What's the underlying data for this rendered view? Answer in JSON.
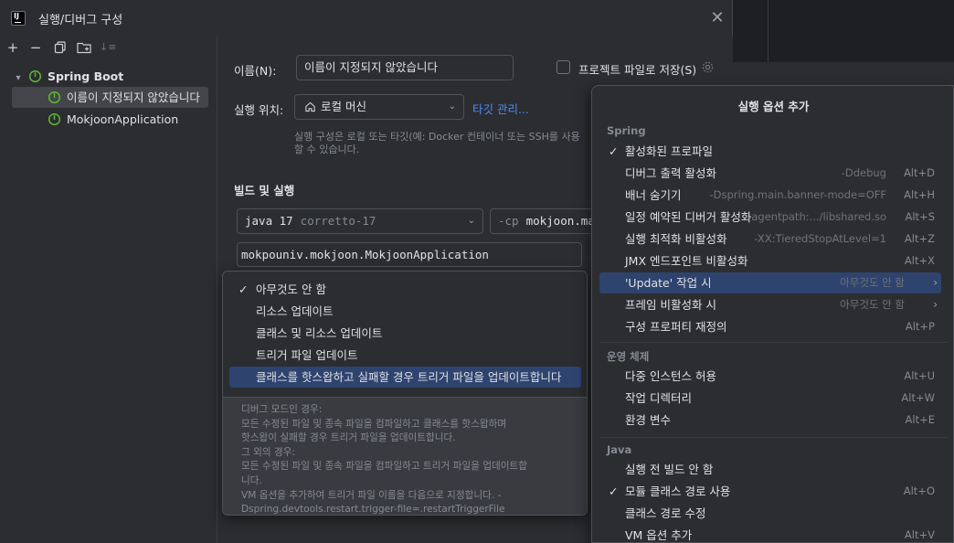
{
  "dialog": {
    "title": "실행/디버그 구성"
  },
  "tree": {
    "group": "Spring Boot",
    "items": [
      "이름이 지정되지 않았습니다",
      "MokjoonApplication"
    ]
  },
  "form": {
    "name_label": "이름(N):",
    "name_value": "이름이 지정되지 않았습니다",
    "save_file_label": "프로젝트 파일로 저장(S)",
    "location_label": "실행 위치:",
    "location_value": "로컬 머신",
    "manage_targets": "타깃 관리...",
    "location_hint_1": "실행 구성은 로컬 또는 타깃(예: Docker 컨테이너 또는 SSH를 사용",
    "location_hint_2": "할 수 있습니다.",
    "build_section": "빌드 및 실행",
    "jdk_name": "java 17",
    "jdk_vendor": "corretto-17",
    "cp_flag": "-cp",
    "cp_value": "mokjoon.mai",
    "main_class": "mokpouniv.mokjoon.MokjoonApplication"
  },
  "update_popup": {
    "items": [
      {
        "label": "아무것도 안 함",
        "checked": true
      },
      {
        "label": "리소스 업데이트"
      },
      {
        "label": "클래스 및 리소스 업데이트"
      },
      {
        "label": "트리거 파일 업데이트"
      },
      {
        "label": "클래스를 핫스왑하고 실패할 경우 트리거 파일을 업데이트합니다",
        "selected": true
      }
    ],
    "description": [
      "디버그 모드인 경우:",
      "모든 수정된 파일 및 종속 파일을 컴파일하고 클래스를 핫스왑하며",
      "핫스왑이 실패할 경우 트리거 파일을 업데이트합니다.",
      "그 외의 경우:",
      "모든 수정된 파일 및 종속 파일을 컴파일하고 트리거 파일을 업데이트합",
      "니다.",
      "VM 옵션을 추가하여 트리거 파일 이름을 다음으로 지정합니다. -",
      "Dspring.devtools.restart.trigger-file=.restartTriggerFile"
    ]
  },
  "options_popup": {
    "title": "실행 옵션 추가",
    "groups": [
      "Spring",
      "운영 체제",
      "Java"
    ],
    "spring_items": [
      {
        "label": "활성화된 프로파일",
        "checked": true,
        "hint": "",
        "key": ""
      },
      {
        "label": "디버그 출력 활성화",
        "hint": "-Ddebug",
        "key": "Alt+D"
      },
      {
        "label": "배너 숨기기",
        "hint": "-Dspring.main.banner-mode=OFF",
        "key": "Alt+H"
      },
      {
        "label": "일정 예약된 디버거 활성화",
        "hint": "-agentpath:.../libshared.so",
        "key": "Alt+S"
      },
      {
        "label": "실행 최적화 비활성화",
        "hint": "-XX:TieredStopAtLevel=1",
        "key": "Alt+Z"
      },
      {
        "label": "JMX 엔드포인트 비활성화",
        "hint": "",
        "key": "Alt+X"
      },
      {
        "label": "'Update' 작업 시",
        "hint": "아무것도 안 함",
        "key": "",
        "submenu": true,
        "selected": true
      },
      {
        "label": "프레임 비활성화 시",
        "hint": "아무것도 안 함",
        "key": "",
        "submenu": true
      },
      {
        "label": "구성 프로퍼티 재정의",
        "hint": "",
        "key": "Alt+P"
      }
    ],
    "os_items": [
      {
        "label": "다중 인스턴스 허용",
        "key": "Alt+U"
      },
      {
        "label": "작업 디렉터리",
        "key": "Alt+W"
      },
      {
        "label": "환경 변수",
        "key": "Alt+E"
      }
    ],
    "java_items": [
      {
        "label": "실행 전 빌드 안 함",
        "key": ""
      },
      {
        "label": "모듈 클래스 경로 사용",
        "checked": true,
        "key": "Alt+O"
      },
      {
        "label": "클래스 경로 수정",
        "key": ""
      },
      {
        "label": "VM 옵션 추가",
        "key": "Alt+V"
      }
    ]
  },
  "glyphs": {
    "check": "✓",
    "close": "✕",
    "chev_down": "⌄",
    "tree_expanded": "▾",
    "submenu": "›",
    "add": "+",
    "remove": "−",
    "sort": "↓≡"
  }
}
